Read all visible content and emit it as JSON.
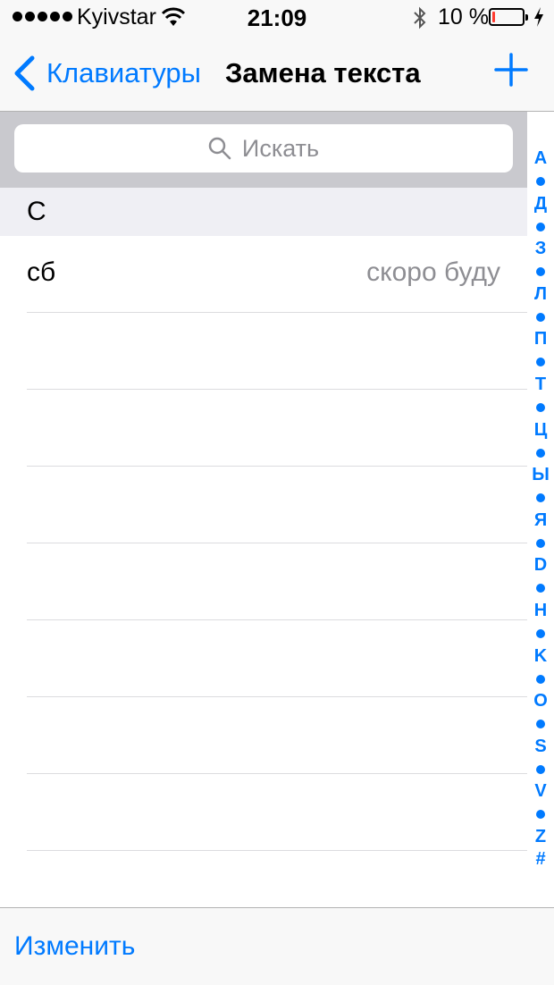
{
  "status_bar": {
    "carrier": "Kyivstar",
    "time": "21:09",
    "battery_percent": "10 %",
    "battery_level": 0.1
  },
  "nav": {
    "back_label": "Клавиатуры",
    "title": "Замена текста"
  },
  "search": {
    "placeholder": "Искать"
  },
  "section": {
    "header": "С",
    "rows": [
      {
        "shortcut": "сб",
        "phrase": "скоро буду"
      },
      {
        "shortcut": "",
        "phrase": ""
      },
      {
        "shortcut": "",
        "phrase": ""
      },
      {
        "shortcut": "",
        "phrase": ""
      },
      {
        "shortcut": "",
        "phrase": ""
      },
      {
        "shortcut": "",
        "phrase": ""
      },
      {
        "shortcut": "",
        "phrase": ""
      },
      {
        "shortcut": "",
        "phrase": ""
      }
    ]
  },
  "index": [
    "А",
    "•",
    "Д",
    "•",
    "З",
    "•",
    "Л",
    "•",
    "П",
    "•",
    "Т",
    "•",
    "Ц",
    "•",
    "Ы",
    "•",
    "Я",
    "•",
    "D",
    "•",
    "H",
    "•",
    "K",
    "•",
    "O",
    "•",
    "S",
    "•",
    "V",
    "•",
    "Z",
    "#"
  ],
  "toolbar": {
    "edit_label": "Изменить"
  },
  "colors": {
    "accent": "#007aff",
    "battery_low": "#ff3b30",
    "secondary_text": "#8e8e93"
  }
}
